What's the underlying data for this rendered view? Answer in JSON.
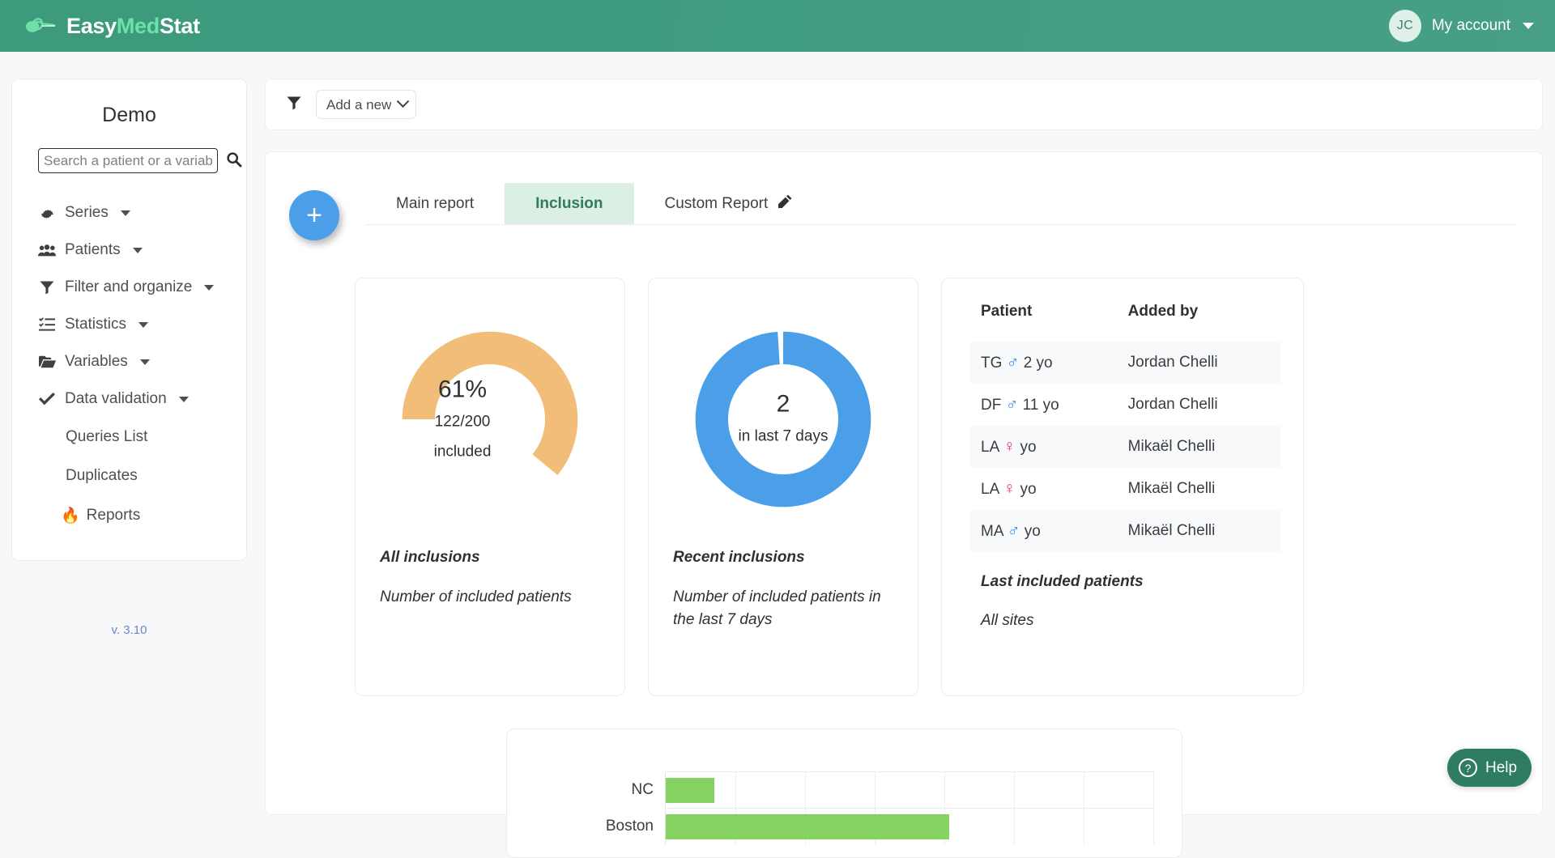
{
  "topbar": {
    "brand_easy": "Easy",
    "brand_med": "Med",
    "brand_stat": "Stat",
    "brand_full": "EasyMedStat",
    "avatar_initials": "JC",
    "account_label": "My account",
    "bg_color": "#3f9b80",
    "accent_color": "#6ee0a8"
  },
  "sidebar": {
    "title": "Demo",
    "search_placeholder": "Search a patient or a variable",
    "search_value": "",
    "items": [
      {
        "label": "Series",
        "icon": "gear-icon",
        "has_caret": true
      },
      {
        "label": "Patients",
        "icon": "users-icon",
        "has_caret": true
      },
      {
        "label": "Filter and organize",
        "icon": "funnel-icon",
        "has_caret": true
      },
      {
        "label": "Statistics",
        "icon": "list-check-icon",
        "has_caret": true
      },
      {
        "label": "Variables",
        "icon": "folder-icon",
        "has_caret": true
      },
      {
        "label": "Data validation",
        "icon": "check-icon",
        "has_caret": true
      }
    ],
    "subitems": [
      {
        "label": "Queries List",
        "emoji": ""
      },
      {
        "label": "Duplicates",
        "emoji": ""
      },
      {
        "label": "Reports",
        "emoji": "🔥"
      }
    ],
    "version": "v. 3.10"
  },
  "filterbar": {
    "filter_icon": "funnel-icon",
    "select_value": "Add a new",
    "select_options": [
      "Add a new"
    ]
  },
  "main": {
    "add_button_label": "+",
    "tabs": [
      {
        "label": "Main report",
        "active": false,
        "icon": ""
      },
      {
        "label": "Inclusion",
        "active": true,
        "icon": ""
      },
      {
        "label": "Custom Report",
        "active": false,
        "icon": "pencil-icon"
      }
    ]
  },
  "cards": {
    "all_inclusions": {
      "percent": "61%",
      "ratio": "122/200",
      "ratio_label": "included",
      "title": "All inclusions",
      "description": "Number of included patients",
      "color": "#f2bd78"
    },
    "recent_inclusions": {
      "count": "2",
      "count_label": "in last 7 days",
      "title": "Recent inclusions",
      "description": "Number of included patients in the last 7 days",
      "color": "#4a9fe8"
    },
    "last_included": {
      "columns": [
        "Patient",
        "Added by"
      ],
      "rows": [
        {
          "initials": "TG",
          "sex": "male",
          "age": "2 yo",
          "added_by": "Jordan Chelli"
        },
        {
          "initials": "DF",
          "sex": "male",
          "age": "11 yo",
          "added_by": "Jordan Chelli"
        },
        {
          "initials": "LA",
          "sex": "female",
          "age": "yo",
          "added_by": "Mikaël Chelli"
        },
        {
          "initials": "LA",
          "sex": "female",
          "age": "yo",
          "added_by": "Mikaël Chelli"
        },
        {
          "initials": "MA",
          "sex": "male",
          "age": "yo",
          "added_by": "Mikaël Chelli"
        }
      ],
      "footer_title": "Last included patients",
      "footer_subtitle": "All sites"
    }
  },
  "chart_data": {
    "type": "bar",
    "orientation": "horizontal",
    "categories": [
      "NC",
      "Boston"
    ],
    "values": [
      10,
      58
    ],
    "title": "",
    "xlabel": "",
    "ylabel": "",
    "xlim": [
      0,
      100
    ],
    "grid": true,
    "legend": false,
    "bar_color": "#85d162"
  },
  "help": {
    "label": "Help",
    "icon": "question-circle-icon",
    "color": "#2e7d63"
  }
}
